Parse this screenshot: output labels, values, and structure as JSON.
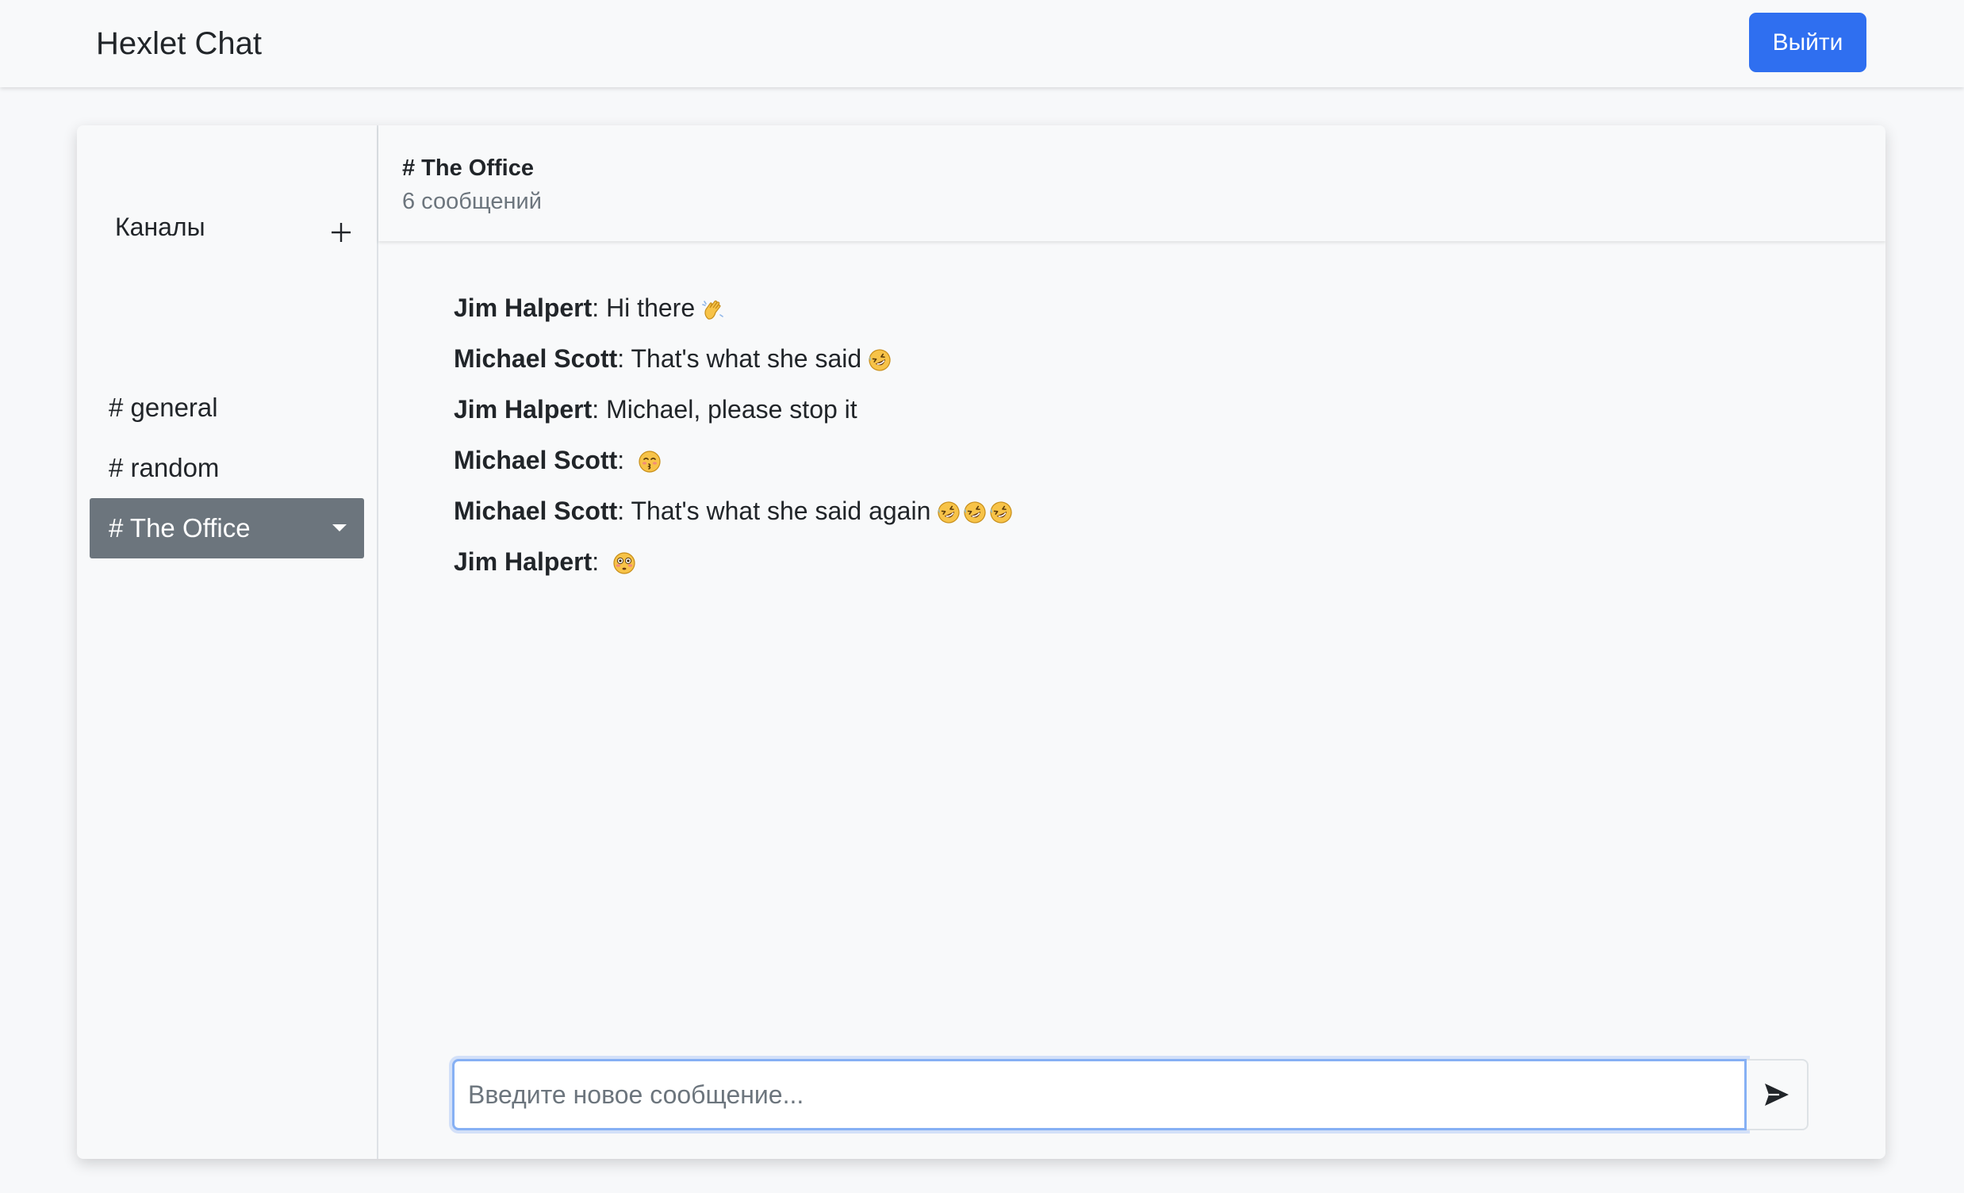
{
  "navbar": {
    "brand": "Hexlet Chat",
    "logout_label": "Выйти",
    "accent_color": "#2f6ff0"
  },
  "sidebar": {
    "channels_title": "Каналы",
    "add_icon": "plus-icon",
    "channels": [
      {
        "label": "# general",
        "active": false
      },
      {
        "label": "# random",
        "active": false
      },
      {
        "label": "# The Office",
        "active": true
      }
    ],
    "active_color": "#6c757d"
  },
  "chat": {
    "title": "# The Office",
    "count": "6 сообщений",
    "messages": [
      {
        "author": "Jim Halpert",
        "text": "Hi there",
        "emoji": [
          "waving-hand-emoji"
        ]
      },
      {
        "author": "Michael Scott",
        "text": "That's what she said",
        "emoji": [
          "rolling-laughing-emoji"
        ]
      },
      {
        "author": "Jim Halpert",
        "text": "Michael, please stop it",
        "emoji": []
      },
      {
        "author": "Michael Scott",
        "text": "",
        "emoji": [
          "kissing-face-emoji"
        ]
      },
      {
        "author": "Michael Scott",
        "text": "That's what she said again",
        "emoji": [
          "rolling-laughing-emoji",
          "rolling-laughing-emoji",
          "rolling-laughing-emoji"
        ]
      },
      {
        "author": "Jim Halpert",
        "text": "",
        "emoji": [
          "flushed-face-emoji"
        ]
      }
    ]
  },
  "composer": {
    "placeholder": "Введите новое сообщение...",
    "value": "",
    "send_icon": "send-arrow-icon"
  }
}
